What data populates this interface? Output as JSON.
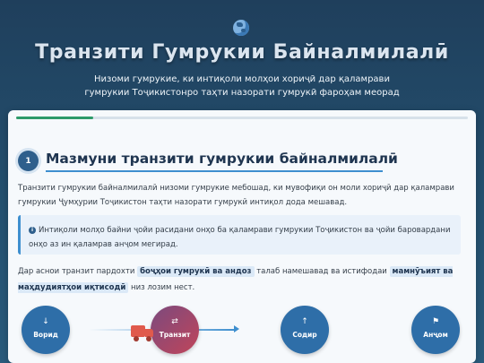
{
  "header": {
    "icon": "globe-icon",
    "title": "Транзити Гумрукии Байналмилалӣ",
    "subtitle": "Низоми гумрукие, ки интиқоли молҳои хориҷӣ дар қаламрави гумрукии Тоҷикистонро таҳти назорати гумрукӣ фароҳам меорад"
  },
  "progress": {
    "fraction": 0.17,
    "color": "#2e9b6a"
  },
  "section": {
    "step_number": "1",
    "title": "Мазмуни транзити гумрукии байналмилалӣ",
    "paragraph": "Транзити гумрукии байналмилалӣ низоми гумрукие мебошад, ки мувофиқи он моли хориҷӣ дар қаламрави гумрукии Ҷумҳурии Тоҷикистон таҳти назорати гумрукӣ интиқол дода мешавад.",
    "note": {
      "icon": "info-icon",
      "text": "Интиқоли молҳо байни ҷойи расидани онҳо ба қаламрави гумрукии Тоҷикистон ва ҷойи баровардани онҳо аз ин қаламрав анҷом мегирад."
    },
    "paragraph2": {
      "before": "Дар аснои транзит пардохти",
      "highlight1": "боҷҳои гумрукӣ ва андоз",
      "middle": "талаб намешавад ва истифодаи",
      "highlight2": "мамнӯъият ва маҳдудиятҳои иқтисодӣ",
      "after": "низ лозим нест."
    }
  },
  "flow": {
    "truck_icon": "truck-icon",
    "nodes": [
      {
        "icon": "↓",
        "icon_name": "arrow-down-icon",
        "label": "Ворид"
      },
      {
        "icon": "⇄",
        "icon_name": "exchange-icon",
        "label": "Транзит"
      },
      {
        "icon": "↑",
        "icon_name": "arrow-up-icon",
        "label": "Содир"
      },
      {
        "icon": "⚑",
        "icon_name": "flag-icon",
        "label": "Анҷом"
      }
    ]
  },
  "colors": {
    "accent": "#3e8fcf",
    "brand": "#2e5f8c",
    "truck": "#e05a4c"
  }
}
